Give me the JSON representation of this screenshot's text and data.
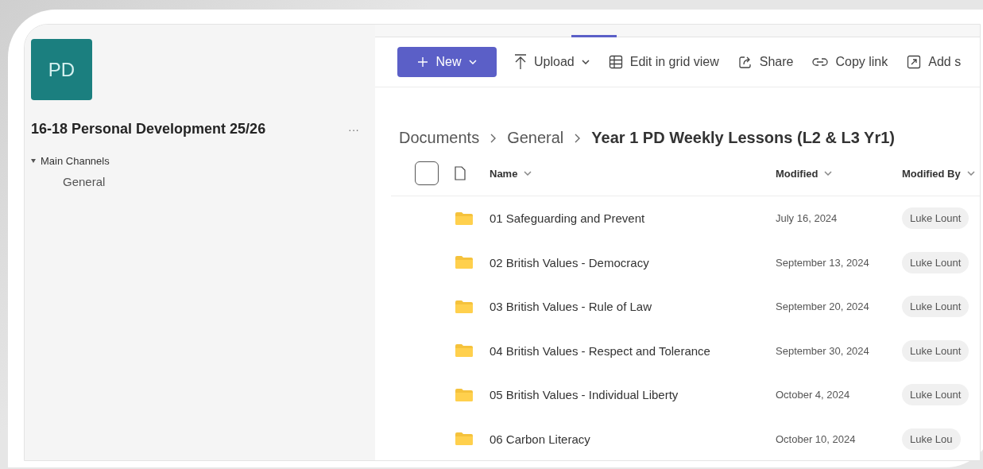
{
  "team": {
    "initials": "PD",
    "name": "16-18 Personal Development 25/26",
    "more": "···"
  },
  "channels": [
    {
      "label": "Main Channels",
      "expanded": true,
      "children": [
        {
          "label": "General"
        }
      ]
    }
  ],
  "toolbar": [
    {
      "kind": "new",
      "label": "New",
      "menu": true
    },
    {
      "kind": "upload",
      "label": "Upload",
      "menu": true
    },
    {
      "kind": "grid",
      "label": "Edit in grid view",
      "menu": false
    },
    {
      "kind": "share",
      "label": "Share",
      "menu": false
    },
    {
      "kind": "link",
      "label": "Copy link",
      "menu": false
    },
    {
      "kind": "add",
      "label": "Add s",
      "menu": false
    }
  ],
  "breadcrumb": [
    "Documents",
    "General",
    "Year 1 PD Weekly Lessons (L2 & L3 Yr1)"
  ],
  "table": {
    "select_all_checked": false,
    "columns": [
      "Name",
      "Modified",
      "Modified By"
    ],
    "rows": [
      {
        "name": "01 Safeguarding and Prevent",
        "modified": "July 16, 2024",
        "modified_by": "Luke Lount"
      },
      {
        "name": "02 British Values - Democracy",
        "modified": "September 13, 2024",
        "modified_by": "Luke Lount"
      },
      {
        "name": "03 British Values - Rule of Law",
        "modified": "September 20, 2024",
        "modified_by": "Luke Lount"
      },
      {
        "name": "04 British Values - Respect and Tolerance",
        "modified": "September 30, 2024",
        "modified_by": "Luke Lount"
      },
      {
        "name": "05 British Values - Individual Liberty",
        "modified": "October 4, 2024",
        "modified_by": "Luke Lount"
      },
      {
        "name": "06 Carbon Literacy",
        "modified": "October 10, 2024",
        "modified_by": "Luke Lou"
      }
    ]
  }
}
